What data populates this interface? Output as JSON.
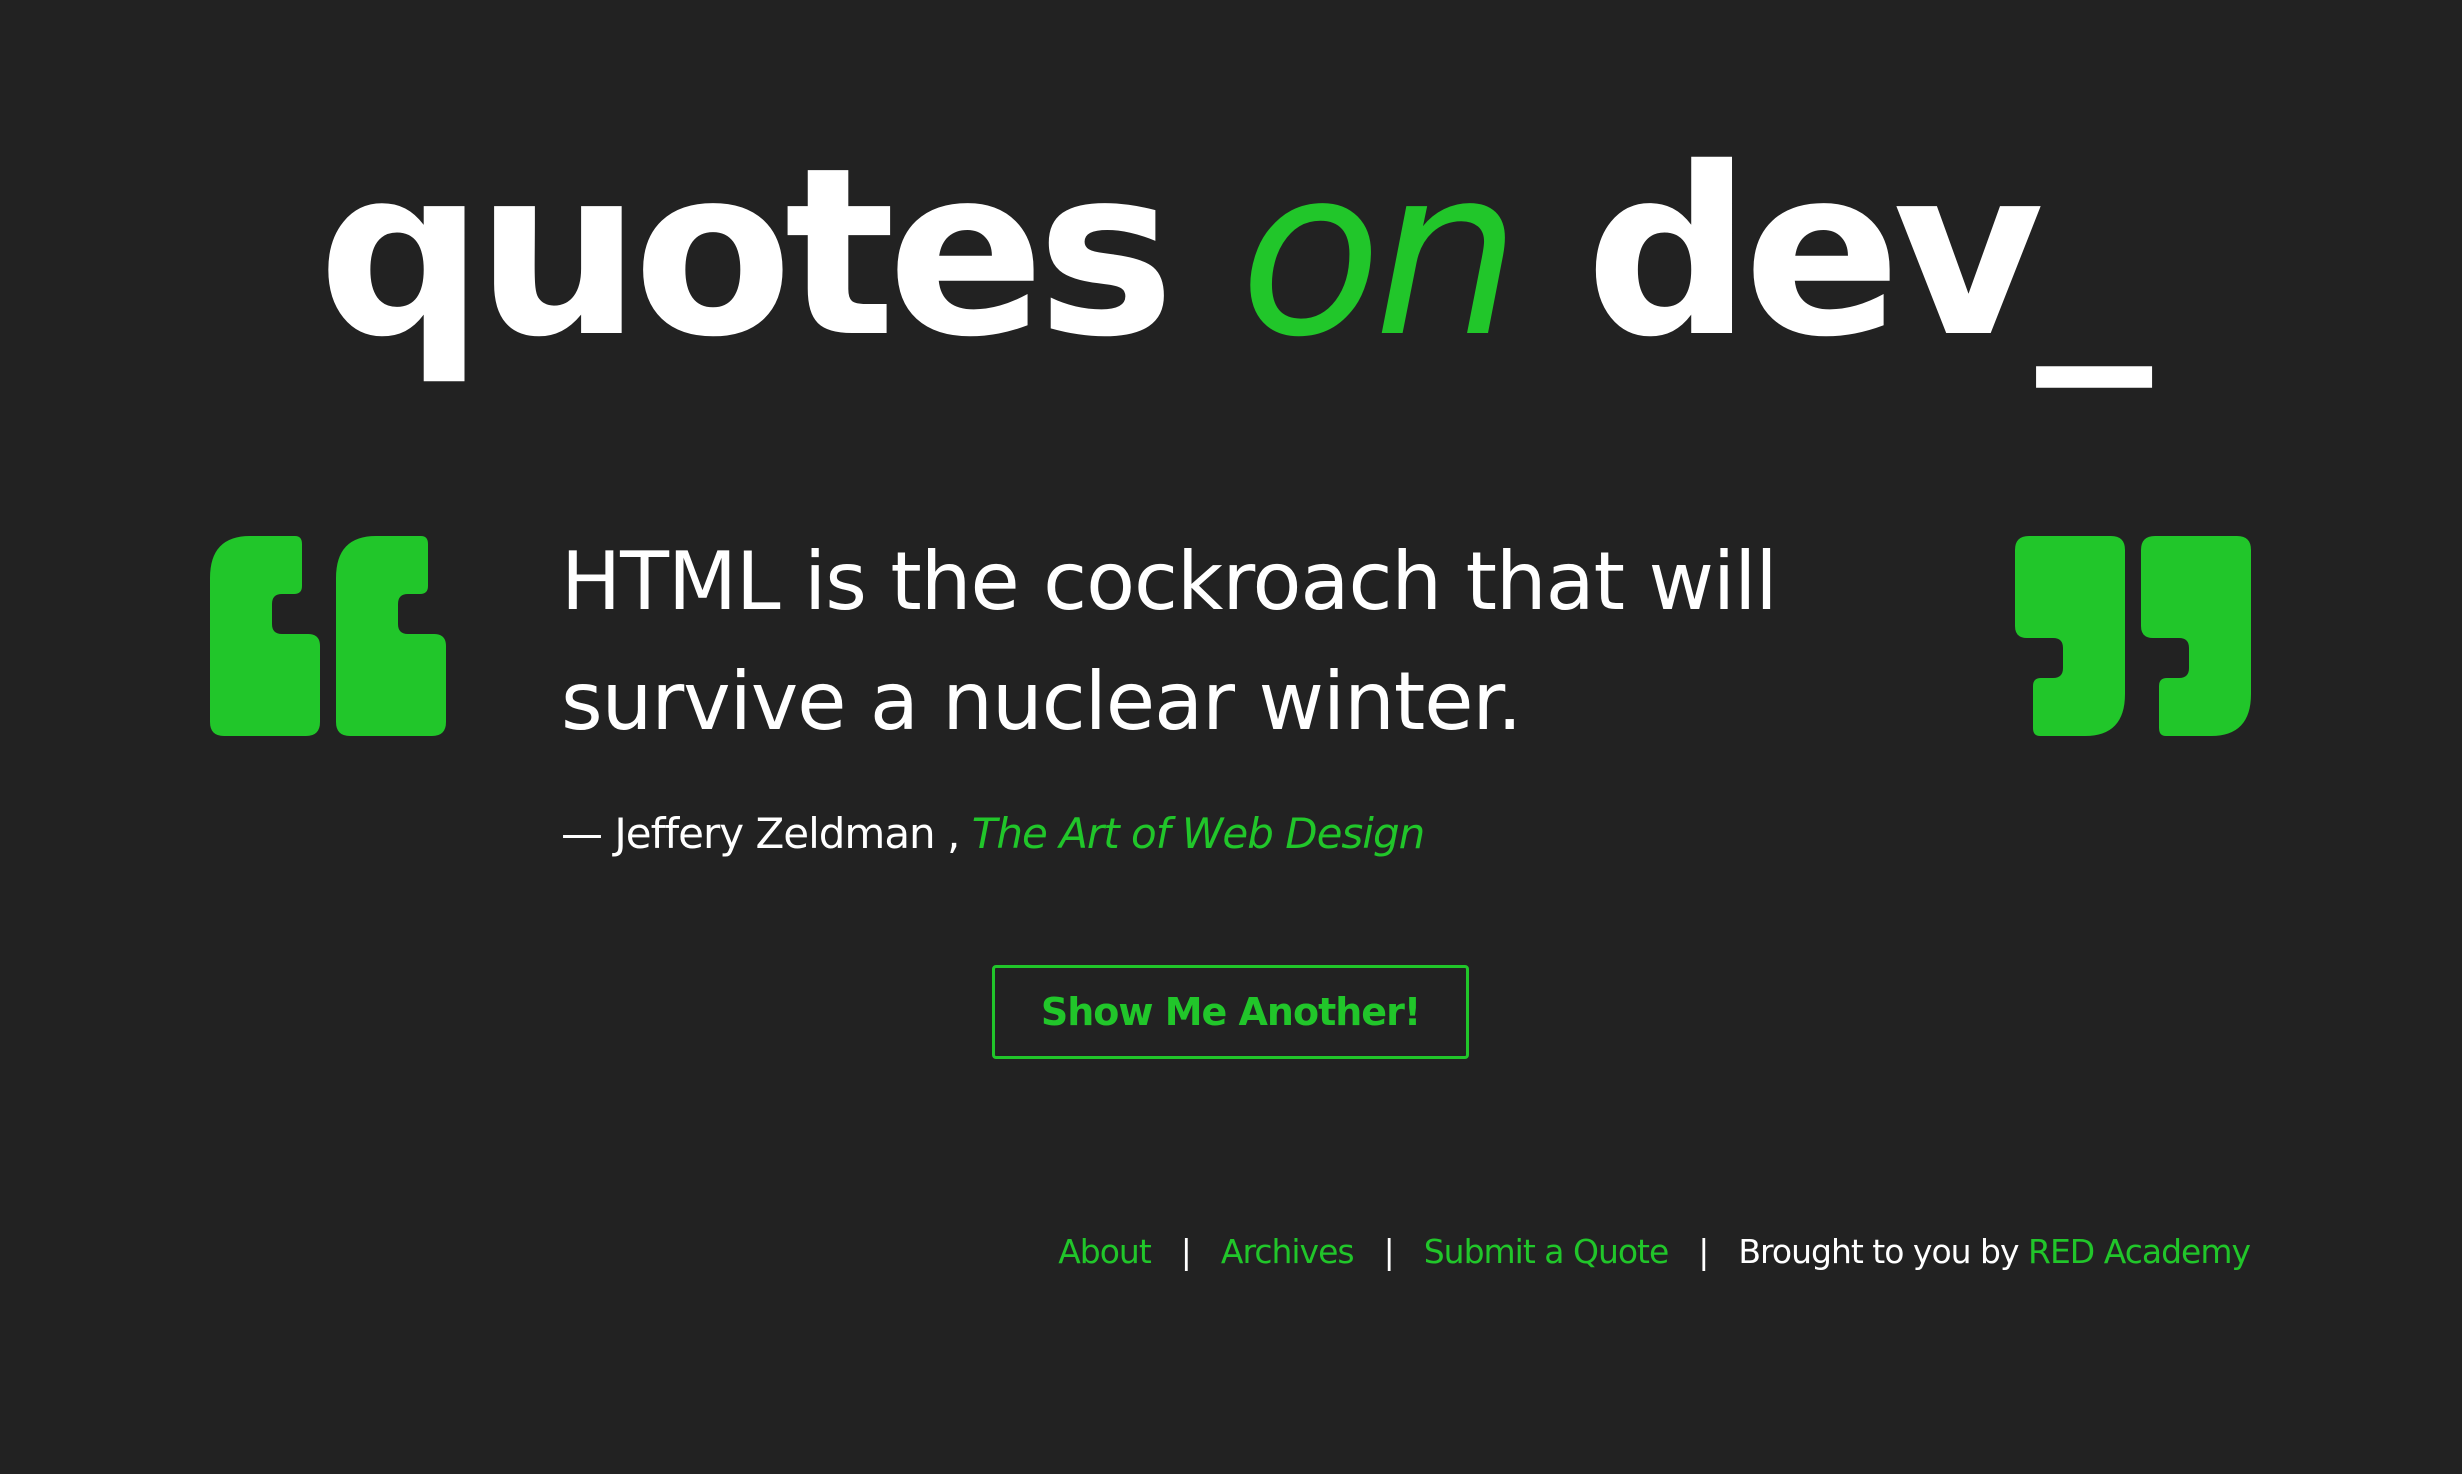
{
  "header": {
    "title_part1": "quotes",
    "title_part2": "on",
    "title_part3": "dev_"
  },
  "quote": {
    "text": "HTML is the cockroach that will survive a nuclear winter.",
    "author": "— Jeffery Zeldman ,",
    "source": "The Art of Web Design"
  },
  "actions": {
    "another_label": "Show Me Another!"
  },
  "footer": {
    "links": {
      "about": "About",
      "archives": "Archives",
      "submit": "Submit a Quote"
    },
    "separator": "|",
    "credit_prefix": "Brought to you by",
    "credit_link": "RED Academy"
  },
  "icons": {
    "open_quote": "open-quote-icon",
    "close_quote": "close-quote-icon"
  },
  "colors": {
    "background": "#222222",
    "accent": "#21c62a",
    "text": "#ffffff"
  }
}
